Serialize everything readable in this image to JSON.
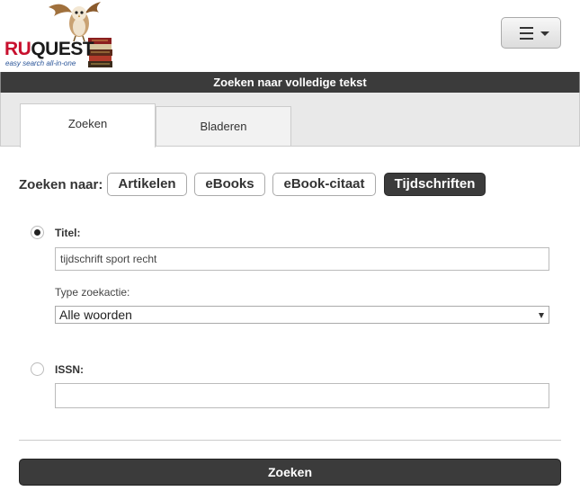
{
  "logo": {
    "brand_ru": "RU",
    "brand_quest": "QUEST",
    "tagline": "easy search all-in-one"
  },
  "menu": {
    "icon": "hamburger-icon",
    "caret_icon": "caret-down-icon"
  },
  "titlebar": {
    "title": "Zoeken naar volledige tekst"
  },
  "tabs": [
    {
      "label": "Zoeken",
      "active": true
    },
    {
      "label": "Bladeren",
      "active": false
    }
  ],
  "search_for": {
    "label": "Zoeken naar:",
    "options": [
      {
        "label": "Artikelen",
        "active": false
      },
      {
        "label": "eBooks",
        "active": false
      },
      {
        "label": "eBook-citaat",
        "active": false
      },
      {
        "label": "Tijdschriften",
        "active": true
      }
    ]
  },
  "form": {
    "title": {
      "label": "Titel:",
      "selected": true,
      "value": "tijdschrift sport recht",
      "search_type_label": "Type zoekactie:",
      "search_type_value": "Alle woorden"
    },
    "issn": {
      "label": "ISSN:",
      "selected": false,
      "value": ""
    }
  },
  "submit": {
    "label": "Zoeken"
  },
  "colors": {
    "dark": "#3b3b3b",
    "brand_red": "#c8102e",
    "tab_bg": "#e9e9e9"
  }
}
